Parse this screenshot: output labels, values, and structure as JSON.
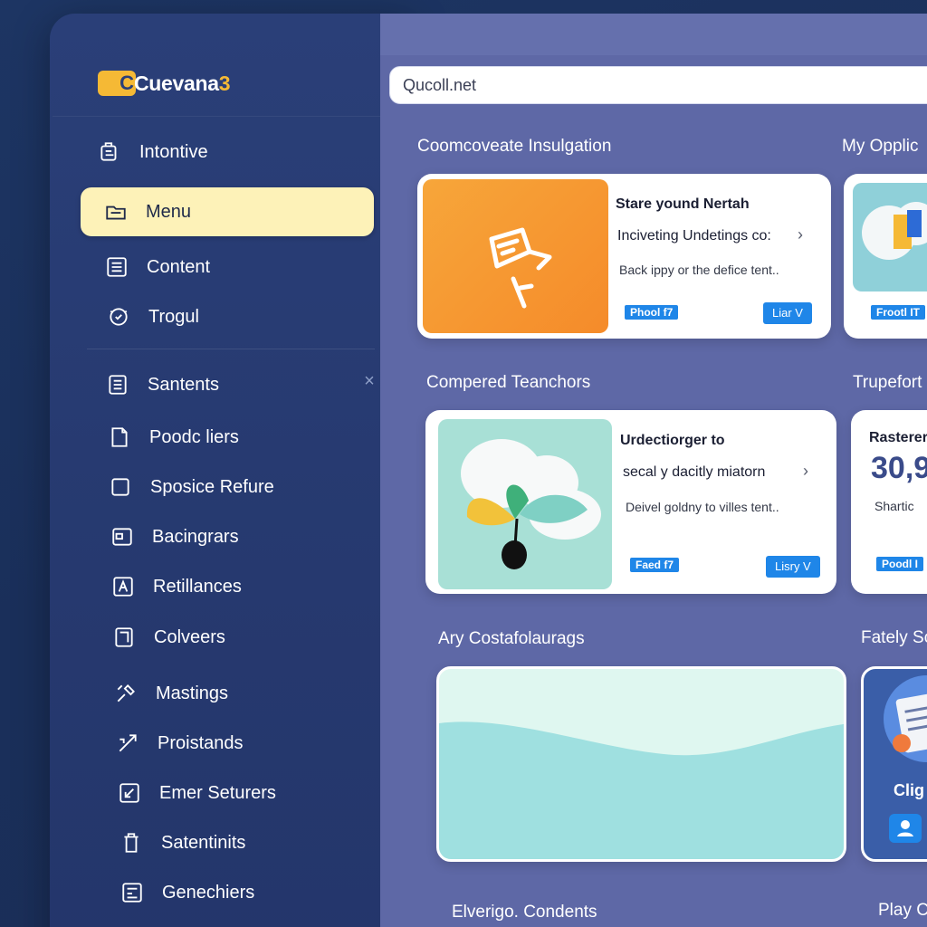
{
  "app": {
    "logo_mark": "C",
    "logo_name": "Cuevana",
    "logo_suffix": "3"
  },
  "sidebar": {
    "items": [
      {
        "label": "Intontive",
        "icon": "clipboard-icon"
      },
      {
        "label": "Menu",
        "icon": "folder-icon",
        "active": true
      },
      {
        "label": "Content",
        "icon": "list-icon"
      },
      {
        "label": "Trogul",
        "icon": "badge-icon"
      },
      {
        "label": "Santents",
        "icon": "document-lines-icon"
      },
      {
        "label": "Poodc liers",
        "icon": "file-icon"
      },
      {
        "label": "Sposice Refure",
        "icon": "square-icon"
      },
      {
        "label": "Bacingrars",
        "icon": "media-icon"
      },
      {
        "label": "Retillances",
        "icon": "pdf-icon"
      },
      {
        "label": "Colveers",
        "icon": "frame-icon"
      },
      {
        "label": "Mastings",
        "icon": "tools-icon"
      },
      {
        "label": "Proistands",
        "icon": "puzzle-icon"
      },
      {
        "label": "Emer Seturers",
        "icon": "edit-icon"
      },
      {
        "label": "Satentinits",
        "icon": "trash-icon"
      },
      {
        "label": "Genechiers",
        "icon": "gallery-icon"
      }
    ],
    "close_symbol": "×"
  },
  "search": {
    "value": "Qucoll.net"
  },
  "sections": {
    "s1_title": "Coomcoveate Insulgation",
    "s1_right": "My Opplic",
    "s2_title": "Compered Teanchors",
    "s2_right": "Trupefort",
    "s3_title": "Ary Costafolaurags",
    "s3_right": "Fately Sc",
    "s4_title": "Elverigo. Condents",
    "s4_right": "Play C"
  },
  "cards": {
    "c1": {
      "title": "Stare yound Nertah",
      "subtitle": "Inciveting Undetings co:",
      "desc": "Back ippy or the defice tent..",
      "tag": "Phool f7",
      "button": "Liar V",
      "chevron": "›"
    },
    "c1_right": {
      "tag": "Frootl IT"
    },
    "c2": {
      "title": "Urdectiorger to",
      "subtitle": "secal y dacitly miatorn",
      "desc": "Deivel goldny to villes tent..",
      "tag": "Faed f7",
      "button": "Lisry V",
      "chevron": "›"
    },
    "c2_right": {
      "title": "Rasterer",
      "value": "30,9",
      "desc": "Shartic",
      "tag": "Poodl I"
    },
    "c3_right": {
      "label": "Clig"
    }
  },
  "colors": {
    "accent": "#f5b935",
    "active_nav": "#fdf2b8",
    "tag_blue": "#1f86e8",
    "panel": "#5e68a6",
    "sidebar": "#2a3f78"
  }
}
